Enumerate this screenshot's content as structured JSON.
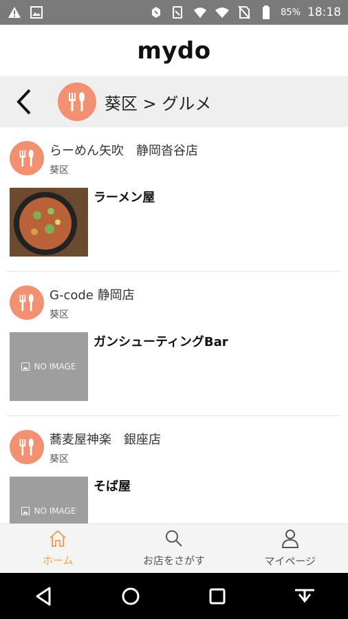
{
  "status_bar": {
    "battery": "85%",
    "time": "18:18",
    "icons": [
      "warning-icon",
      "image-icon",
      "data-saver-icon",
      "signal-no-sim-icon",
      "wifi-calling-icon",
      "wifi-icon",
      "no-sim-icon",
      "battery-icon"
    ]
  },
  "header": {
    "brand": "mydo"
  },
  "breadcrumb": {
    "text": "葵区 > グルメ",
    "icon": "restaurant-icon"
  },
  "shops": [
    {
      "name": "らーめん矢吹　静岡沓谷店",
      "area": "葵区",
      "genre": "ラーメン屋",
      "image": "photo"
    },
    {
      "name": "G-code 静岡店",
      "area": "葵区",
      "genre": "ガンシューティングBar",
      "image": "NO IMAGE"
    },
    {
      "name": "蕎麦屋神楽　銀座店",
      "area": "葵区",
      "genre": "そば屋",
      "image": "NO IMAGE"
    }
  ],
  "bottom_nav": {
    "items": [
      {
        "label": "ホーム",
        "icon": "home-icon",
        "active": true
      },
      {
        "label": "お店をさがす",
        "icon": "search-icon",
        "active": false
      },
      {
        "label": "マイページ",
        "icon": "person-icon",
        "active": false
      }
    ]
  },
  "colors": {
    "accent": "#f29072",
    "active_nav": "#f2a05a",
    "status_bar": "#7a7a7a"
  }
}
